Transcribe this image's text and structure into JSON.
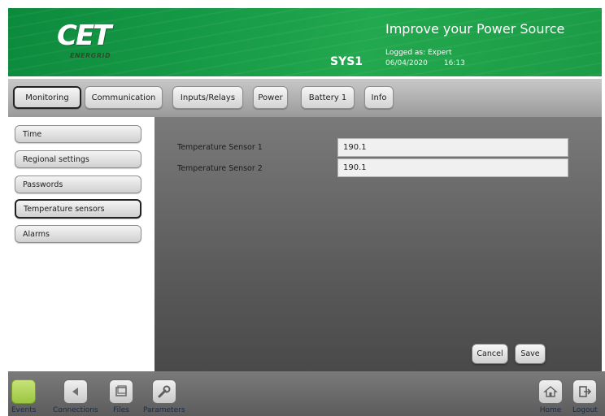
{
  "header": {
    "logo_text": "CET",
    "logo_subtext": "ENERGRID",
    "tagline": "Improve your Power Source",
    "system_name": "SYS1",
    "logged_as": "Logged as: Expert",
    "date": "06/04/2020",
    "time": "16:13"
  },
  "tabs": [
    {
      "label": "Monitoring",
      "active": true
    },
    {
      "label": "Communication"
    },
    {
      "label": "Inputs/Relays"
    },
    {
      "label": "Power"
    },
    {
      "label": "Battery 1"
    },
    {
      "label": "Info"
    }
  ],
  "sidebar": {
    "items": [
      {
        "label": "Time"
      },
      {
        "label": "Regional settings"
      },
      {
        "label": "Passwords"
      },
      {
        "label": "Temperature sensors",
        "active": true
      },
      {
        "label": "Alarms"
      }
    ]
  },
  "main": {
    "fields": [
      {
        "label": "Temperature Sensor 1",
        "value": "190.1"
      },
      {
        "label": "Temperature Sensor 2",
        "value": "190.1"
      }
    ],
    "cancel_label": "Cancel",
    "save_label": "Save"
  },
  "bottom": {
    "left": [
      {
        "label": "Events",
        "icon": "events-icon"
      },
      {
        "label": "Connections",
        "icon": "connections-icon"
      },
      {
        "label": "Files",
        "icon": "files-icon"
      },
      {
        "label": "Parameters",
        "icon": "wrench-icon"
      }
    ],
    "right": [
      {
        "label": "Home",
        "icon": "home-icon"
      },
      {
        "label": "Logout",
        "icon": "logout-icon"
      }
    ]
  },
  "colors": {
    "header_green": "#179b47",
    "events_green": "#9bc73f"
  }
}
